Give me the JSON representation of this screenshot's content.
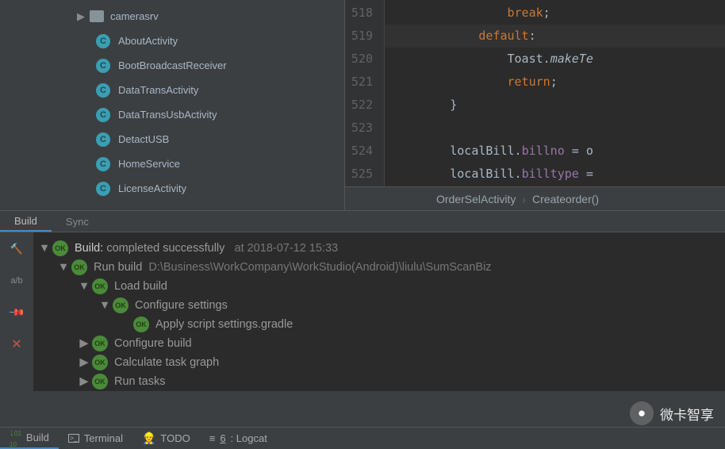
{
  "project": {
    "folder": "camerasrv",
    "classes": [
      "AboutActivity",
      "BootBroadcastReceiver",
      "DataTransActivity",
      "DataTransUsbActivity",
      "DetactUSB",
      "HomeService",
      "LicenseActivity"
    ]
  },
  "editor": {
    "lines": [
      {
        "num": "518",
        "text": "                break;"
      },
      {
        "num": "519",
        "text": "            default:"
      },
      {
        "num": "520",
        "text": "                Toast.makeTe"
      },
      {
        "num": "521",
        "text": "                return;"
      },
      {
        "num": "522",
        "text": "        }"
      },
      {
        "num": "523",
        "text": ""
      },
      {
        "num": "524",
        "text": "        localBill.billno = o"
      },
      {
        "num": "525",
        "text": "        localBill.billtype ="
      }
    ],
    "breadcrumb": {
      "a": "OrderSelActivity",
      "b": "Createorder()"
    }
  },
  "tabs": {
    "build": "Build",
    "sync": "Sync"
  },
  "build": {
    "root": "Build:",
    "status": "completed successfully",
    "time": "at 2018-07-12 15:33",
    "run": "Run build",
    "path": "D:\\Business\\WorkCompany\\WorkStudio(Android)\\liulu\\SumScanBiz",
    "load": "Load build",
    "conf_settings": "Configure settings",
    "apply": "Apply script settings.gradle",
    "conf_build": "Configure build",
    "calc": "Calculate task graph",
    "runtasks": "Run tasks"
  },
  "bottom": {
    "build": "Build",
    "terminal": "Terminal",
    "todo": "TODO",
    "logcat_prefix": "6",
    "logcat": ": Logcat"
  },
  "watermark": "微卡智享"
}
